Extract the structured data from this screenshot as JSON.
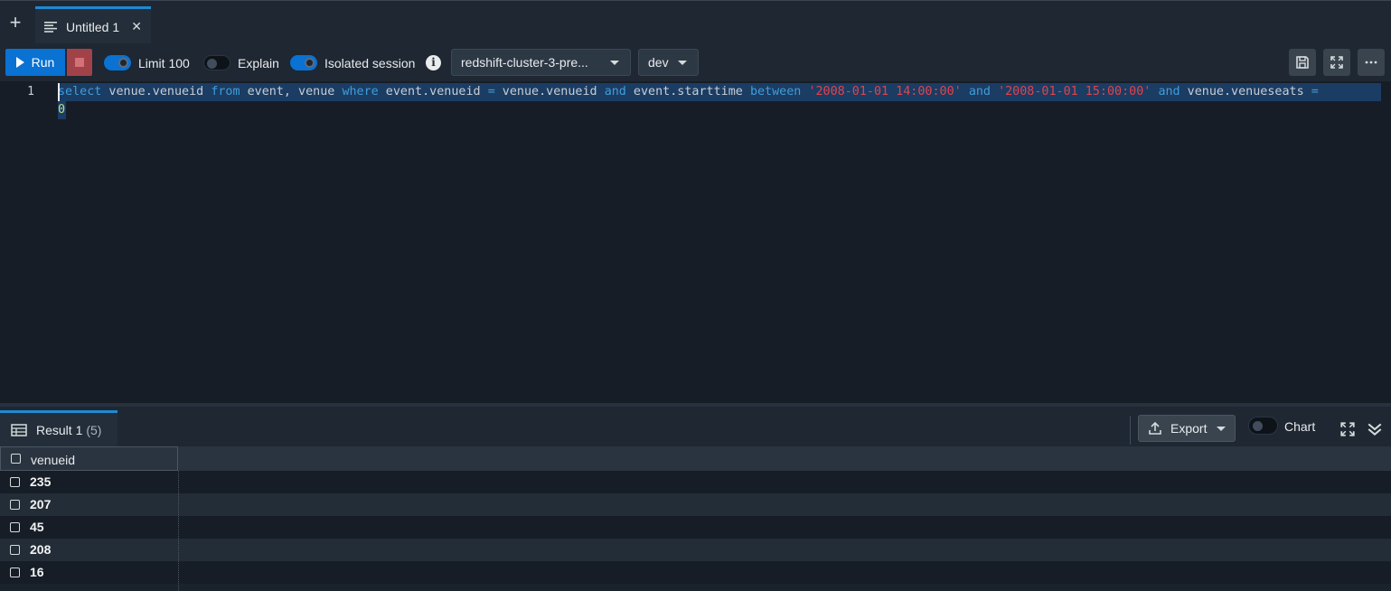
{
  "tabs": [
    {
      "label": "Untitled 1",
      "active": true
    }
  ],
  "toolbar": {
    "run_label": "Run",
    "limit_label": "Limit 100",
    "limit_on": true,
    "explain_label": "Explain",
    "explain_on": false,
    "isolated_label": "Isolated session",
    "isolated_on": true,
    "cluster_select": "redshift-cluster-3-pre...",
    "database_select": "dev"
  },
  "editor": {
    "line_number": "1",
    "line_continuation": "0"
  },
  "result": {
    "tab_label": "Result 1",
    "tab_count": "(5)",
    "export_label": "Export",
    "chart_label": "Chart",
    "chart_on": false,
    "columns": [
      "venueid"
    ],
    "rows": [
      "235",
      "207",
      "45",
      "208",
      "16"
    ]
  },
  "colors": {
    "accent": "#0972d3",
    "stop": "#a14249",
    "keyword": "#3f9ddb",
    "string": "#e2434d",
    "number": "#b9e08b"
  }
}
